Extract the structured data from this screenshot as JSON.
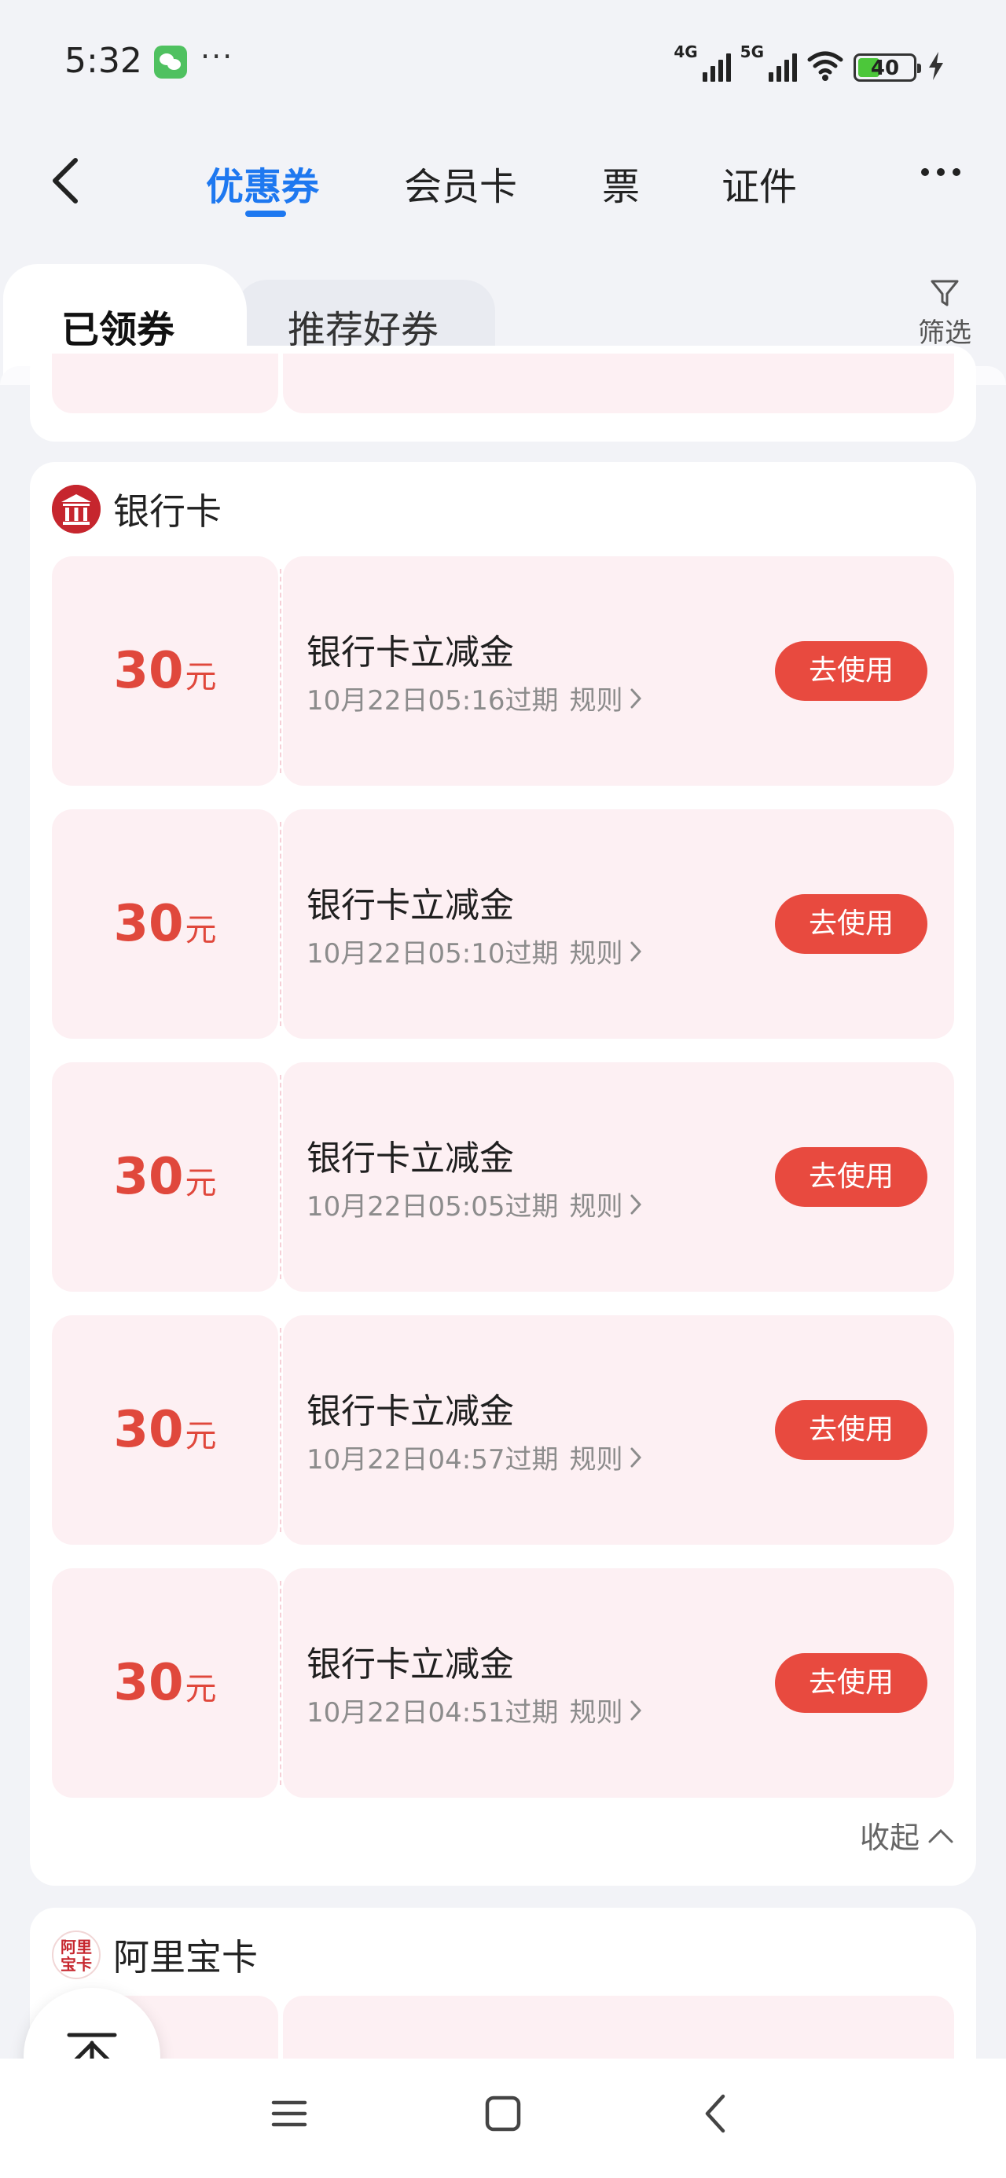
{
  "status_bar": {
    "time": "5:32",
    "dots": "···",
    "network_4g": "4G",
    "network_5g": "5G",
    "battery": "40",
    "battery_level": 0.4
  },
  "header": {
    "tabs": [
      "优惠券",
      "会员卡",
      "票",
      "证件"
    ],
    "active_tab": "优惠券"
  },
  "subtabs": {
    "active": "已领券",
    "inactive": "推荐好券",
    "filter_label": "筛选"
  },
  "bank_section": {
    "title": "银行卡",
    "coupons": [
      {
        "amount": "30",
        "unit": "元",
        "name": "银行卡立减金",
        "expiry": "10月22日05:16过期",
        "rule": "规则",
        "button": "去使用"
      },
      {
        "amount": "30",
        "unit": "元",
        "name": "银行卡立减金",
        "expiry": "10月22日05:10过期",
        "rule": "规则",
        "button": "去使用"
      },
      {
        "amount": "30",
        "unit": "元",
        "name": "银行卡立减金",
        "expiry": "10月22日05:05过期",
        "rule": "规则",
        "button": "去使用"
      },
      {
        "amount": "30",
        "unit": "元",
        "name": "银行卡立减金",
        "expiry": "10月22日04:57过期",
        "rule": "规则",
        "button": "去使用"
      },
      {
        "amount": "30",
        "unit": "元",
        "name": "银行卡立减金",
        "expiry": "10月22日04:51过期",
        "rule": "规则",
        "button": "去使用"
      }
    ],
    "collapse_label": "收起"
  },
  "alipay_section": {
    "title": "阿里宝卡",
    "icon_text": "阿里宝卡"
  },
  "colors": {
    "accent_blue": "#1e78f0",
    "coupon_red": "#e0483c",
    "button_red": "#e84a3f",
    "coupon_bg": "#fdf0f3"
  },
  "icons": {
    "back": "chevron-left-icon",
    "more": "more-dots-icon",
    "filter": "filter-funnel-icon",
    "bank": "bank-icon",
    "back_to_top": "arrow-up-to-top-icon",
    "sys_menu": "menu-icon",
    "sys_home": "home-square-icon",
    "sys_back": "back-chevron-icon"
  }
}
